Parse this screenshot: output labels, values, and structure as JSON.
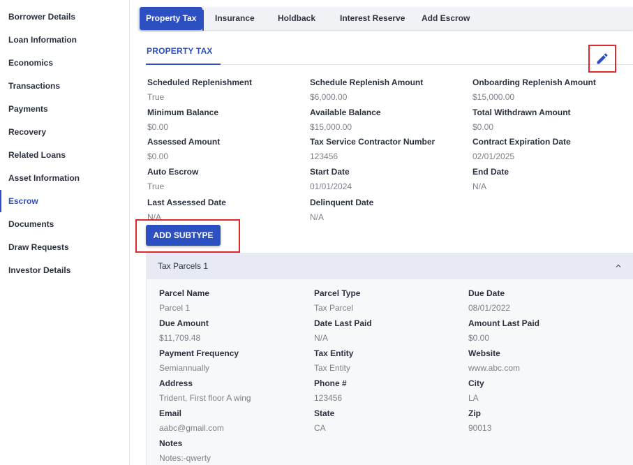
{
  "sidebar": {
    "items": [
      {
        "label": "Borrower Details"
      },
      {
        "label": "Loan Information"
      },
      {
        "label": "Economics"
      },
      {
        "label": "Transactions"
      },
      {
        "label": "Payments"
      },
      {
        "label": "Recovery"
      },
      {
        "label": "Related Loans"
      },
      {
        "label": "Asset Information"
      },
      {
        "label": "Escrow",
        "active": true
      },
      {
        "label": "Documents"
      },
      {
        "label": "Draw Requests"
      },
      {
        "label": "Investor Details"
      }
    ]
  },
  "tabs": [
    {
      "label": "Property Tax",
      "active": true
    },
    {
      "label": "Insurance"
    },
    {
      "label": "Holdback"
    },
    {
      "label": "Interest Reserve"
    },
    {
      "label": "Add Escrow"
    }
  ],
  "section": {
    "title": "PROPERTY TAX",
    "edit_icon": "pencil-icon"
  },
  "property_tax": {
    "scheduled_replenishment": {
      "label": "Scheduled Replenishment",
      "value": "True"
    },
    "schedule_replenish_amount": {
      "label": "Schedule Replenish Amount",
      "value": "$6,000.00"
    },
    "onboarding_replenish_amount": {
      "label": "Onboarding Replenish Amount",
      "value": "$15,000.00"
    },
    "minimum_balance": {
      "label": "Minimum Balance",
      "value": "$0.00"
    },
    "available_balance": {
      "label": "Available Balance",
      "value": "$15,000.00"
    },
    "total_withdrawn_amount": {
      "label": "Total Withdrawn Amount",
      "value": "$0.00"
    },
    "assessed_amount": {
      "label": "Assessed Amount",
      "value": "$0.00"
    },
    "tax_service_contractor_number": {
      "label": "Tax Service Contractor Number",
      "value": "123456"
    },
    "contract_expiration_date": {
      "label": "Contract Expiration Date",
      "value": "02/01/2025"
    },
    "auto_escrow": {
      "label": "Auto Escrow",
      "value": "True"
    },
    "start_date": {
      "label": "Start Date",
      "value": "01/01/2024"
    },
    "end_date": {
      "label": "End Date",
      "value": "N/A"
    },
    "last_assessed_date": {
      "label": "Last Assessed Date",
      "value": "N/A"
    },
    "delinquent_date": {
      "label": "Delinquent Date",
      "value": "N/A"
    }
  },
  "add_subtype_label": "ADD SUBTYPE",
  "parcel": {
    "title": "Tax Parcels 1",
    "collapse_icon": "chevron-up-icon",
    "fields": {
      "parcel_name": {
        "label": "Parcel Name",
        "value": "Parcel 1"
      },
      "parcel_type": {
        "label": "Parcel Type",
        "value": "Tax Parcel"
      },
      "due_date": {
        "label": "Due Date",
        "value": "08/01/2022"
      },
      "due_amount": {
        "label": "Due Amount",
        "value": "$11,709.48"
      },
      "date_last_paid": {
        "label": "Date Last Paid",
        "value": "N/A"
      },
      "amount_last_paid": {
        "label": "Amount Last Paid",
        "value": "$0.00"
      },
      "payment_frequency": {
        "label": "Payment Frequency",
        "value": "Semiannually"
      },
      "tax_entity": {
        "label": "Tax Entity",
        "value": "Tax Entity"
      },
      "website": {
        "label": "Website",
        "value": "www.abc.com"
      },
      "address": {
        "label": "Address",
        "value": "Trident, First floor A wing"
      },
      "phone": {
        "label": "Phone #",
        "value": "123456"
      },
      "city": {
        "label": "City",
        "value": "LA"
      },
      "email": {
        "label": "Email",
        "value": "aabc@gmail.com"
      },
      "state": {
        "label": "State",
        "value": "CA"
      },
      "zip": {
        "label": "Zip",
        "value": "90013"
      },
      "notes": {
        "label": "Notes",
        "value": "Notes:-qwerty"
      }
    }
  },
  "colors": {
    "accent": "#2c4fc2",
    "highlight_red": "#e0282b"
  }
}
